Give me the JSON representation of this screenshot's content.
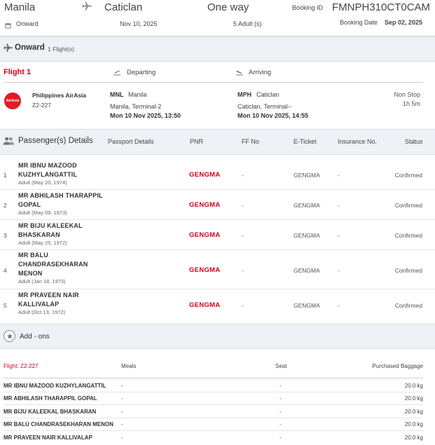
{
  "header": {
    "from": "Manila",
    "to": "Caticlan",
    "trip_type": "One way",
    "booking_id_label": "Booking ID",
    "booking_id": "FMNPH310CT0CAM",
    "onward_label": "Onward",
    "date": "Nov 10, 2025",
    "pax_summary": "5 Adult (s)",
    "booking_date_label": "Booking Date",
    "booking_date": "Sep 02, 2025"
  },
  "onward": {
    "title": "Onward",
    "count": "1 Flight(s)"
  },
  "flight": {
    "label": "Flight 1",
    "departing_label": "Departing",
    "arriving_label": "Arriving",
    "airline_name": "Philippines AirAsia",
    "flight_no": "Z2-227",
    "logo_text": "AirAsia",
    "dep_code": "MNL",
    "dep_city": "Manila",
    "dep_terminal": "Manila, Terminal-2",
    "dep_time": "Mon 10 Nov 2025, 13:50",
    "arr_code": "MPH",
    "arr_city": "Caticlan",
    "arr_terminal": "Caticlan, Terminal--",
    "arr_time": "Mon 10 Nov 2025, 14:55",
    "stops": "Non Stop",
    "duration": "1h 5m"
  },
  "passengers_section": {
    "title": "Passenger(s) Details",
    "columns": [
      "Passport Details",
      "PNR",
      "FF No",
      "E-Ticket",
      "Insurance No.",
      "Status"
    ]
  },
  "passengers": [
    {
      "num": "1",
      "name_lines": [
        "MR IBNU MAZOOD",
        "KUZHYLANGATTIL"
      ],
      "sub": "Adult (May 20, 1974)",
      "passport": "",
      "pnr": "GENGMA",
      "ff": "-",
      "eticket": "GENGMA",
      "insurance": "-",
      "status": "Confirmed"
    },
    {
      "num": "2",
      "name_lines": [
        "MR ABHILASH THARAPPIL",
        "GOPAL"
      ],
      "sub": "Adult (May 09, 1973)",
      "passport": "",
      "pnr": "GENGMA",
      "ff": "-",
      "eticket": "GENGMA",
      "insurance": "-",
      "status": "Confirmed"
    },
    {
      "num": "3",
      "name_lines": [
        "MR BIJU KALEEKAL",
        "BHASKARAN"
      ],
      "sub": "Adult (May 25, 1972)",
      "passport": "",
      "pnr": "GENGMA",
      "ff": "-",
      "eticket": "GENGMA",
      "insurance": "-",
      "status": "Confirmed"
    },
    {
      "num": "4",
      "name_lines": [
        "MR BALU",
        "CHANDRASEKHARAN",
        "MENON"
      ],
      "sub": "Adult (Jan 18, 1973)",
      "passport": "",
      "pnr": "GENGMA",
      "ff": "-",
      "eticket": "GENGMA",
      "insurance": "-",
      "status": "Confirmed"
    },
    {
      "num": "5",
      "name_lines": [
        "MR PRAVEEN NAIR",
        "KALLIVALAP"
      ],
      "sub": "Adult (Oct 13, 1972)",
      "passport": "",
      "pnr": "GENGMA",
      "ff": "-",
      "eticket": "GENGMA",
      "insurance": "-",
      "status": "Confirmed"
    }
  ],
  "addons": {
    "title": "Add - ons",
    "flight_label": "Flight: Z2-227",
    "col_meals": "Meals",
    "col_seat": "Seat",
    "col_baggage": "Purchased Baggage",
    "rows": [
      {
        "name": "MR IBNU MAZOOD KUZHYLANGATTIL",
        "meals": "-",
        "seat": "-",
        "baggage": "20.0 kg"
      },
      {
        "name": "MR ABHILASH THARAPPIL GOPAL",
        "meals": "-",
        "seat": "-",
        "baggage": "20.0 kg"
      },
      {
        "name": "MR BIJU KALEEKAL BHASKARAN",
        "meals": "-",
        "seat": "-",
        "baggage": "20.0 kg"
      },
      {
        "name": "MR BALU CHANDRASEKHARAN MENON",
        "meals": "-",
        "seat": "-",
        "baggage": "20.0 kg"
      },
      {
        "name": "MR PRAVEEN NAIR KALLIVALAP",
        "meals": "-",
        "seat": "-",
        "baggage": "20.0 kg"
      }
    ]
  },
  "colors": {
    "accent_red": "#d0021b",
    "band_bg": "#eef1f5",
    "logo_red": "#e31b23"
  }
}
